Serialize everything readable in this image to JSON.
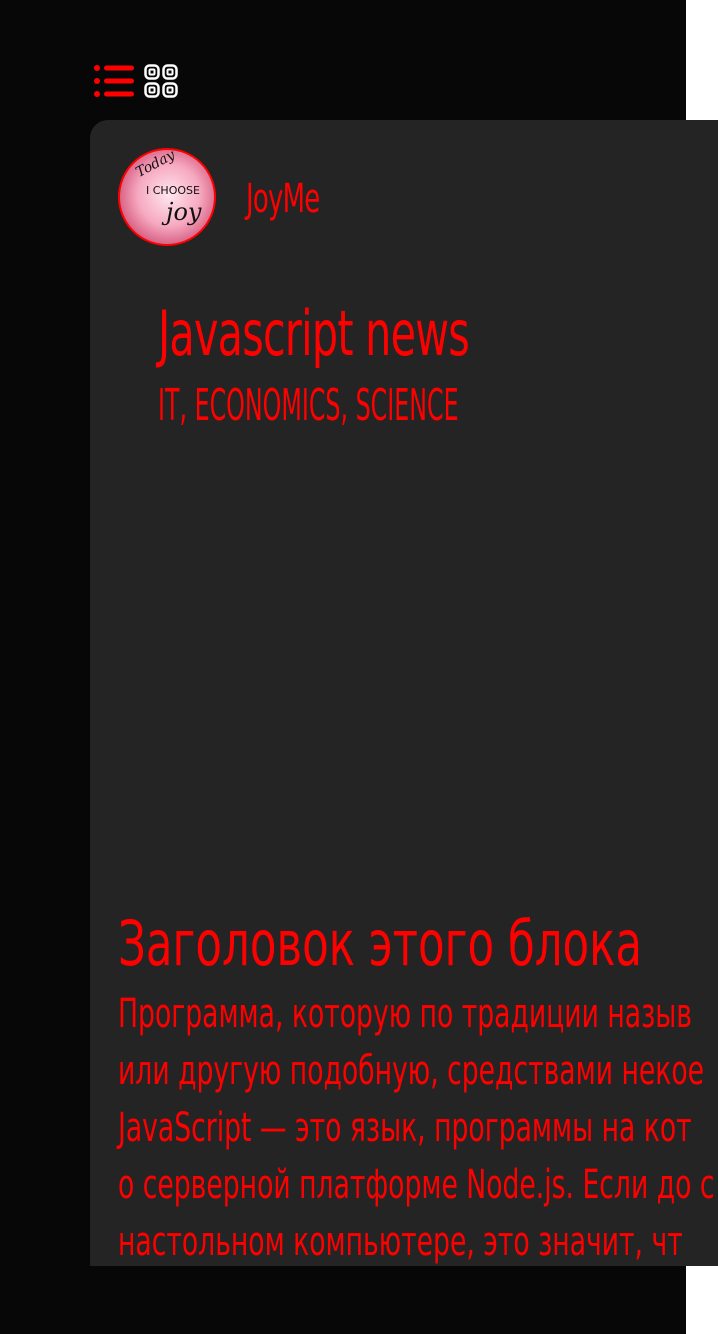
{
  "header": {
    "list_view_icon": "list-icon",
    "grid_view_icon": "grid-icon"
  },
  "profile": {
    "avatar_text": [
      "Today",
      "I CHOOSE",
      "joy"
    ],
    "username": "JoyMe"
  },
  "blog": {
    "title": "Javascript news",
    "tagline": "IT, ECONOMICS, SCIENCE"
  },
  "post": {
    "heading": "Заголовок этого блока",
    "lines": [
      "Программа, которую по традиции назыв",
      "или другую подобную, средствами некое",
      "JavaScript — это язык, программы на кот",
      "о серверной платформе Node.js. Если до с",
      "настольном компьютере, это значит, чт"
    ]
  },
  "colors": {
    "accent": "#ff0000",
    "background": "#070707",
    "card": "#242424"
  }
}
